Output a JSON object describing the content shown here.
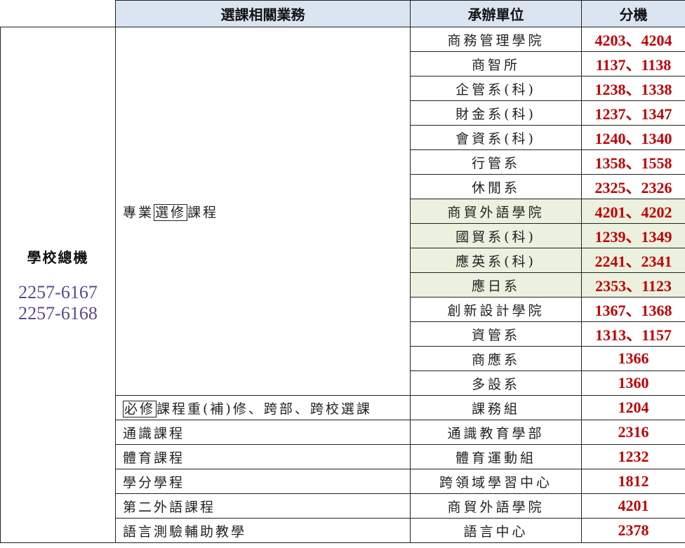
{
  "header": {
    "col_topic": "選課相關業務",
    "col_unit": "承辦單位",
    "col_ext": "分機"
  },
  "school": {
    "title": "學校總機",
    "phones": [
      "2257-6167",
      "2257-6168"
    ]
  },
  "elective": {
    "pre": "專業",
    "boxed": "選修",
    "post": "課程",
    "rows": [
      {
        "unit": "商務管理學院",
        "ext": "4203、4204"
      },
      {
        "unit": "商智所",
        "ext": "1137、1138"
      },
      {
        "unit": "企管系(科)",
        "ext": "1238、1338"
      },
      {
        "unit": "財金系(科)",
        "ext": "1237、1347"
      },
      {
        "unit": "會資系(科)",
        "ext": "1240、1340"
      },
      {
        "unit": "行管系",
        "ext": "1358、1558"
      },
      {
        "unit": "休閒系",
        "ext": "2325、2326"
      },
      {
        "unit": "商貿外語學院",
        "ext": "4201、4202"
      },
      {
        "unit": "國貿系(科)",
        "ext": "1239、1349"
      },
      {
        "unit": "應英系(科)",
        "ext": "2241、2341"
      },
      {
        "unit": "應日系",
        "ext": "2353、1123"
      },
      {
        "unit": "創新設計學院",
        "ext": "1367、1368"
      },
      {
        "unit": "資管系",
        "ext": "1313、1157"
      },
      {
        "unit": "商應系",
        "ext": "1366"
      },
      {
        "unit": "多設系",
        "ext": "1360"
      }
    ]
  },
  "required": {
    "boxed": "必修",
    "post": "課程重(補)修、跨部、跨校選課",
    "unit": "課務組",
    "ext": "1204"
  },
  "others": [
    {
      "topic": "通識課程",
      "unit": "通識教育學部",
      "ext": "2316"
    },
    {
      "topic": "體育課程",
      "unit": "體育運動組",
      "ext": "1232"
    },
    {
      "topic": "學分學程",
      "unit": "跨領域學習中心",
      "ext": "1812"
    },
    {
      "topic": "第二外語課程",
      "unit": "商貿外語學院",
      "ext": "4201"
    },
    {
      "topic": "語言測驗輔助教學",
      "unit": "語言中心",
      "ext": "2378"
    }
  ],
  "colors": {
    "header_bg": "#dbe5f1",
    "highlight_bg": "#ebf1de",
    "ext_text": "#c00000",
    "phone_text": "#5b4a8a"
  }
}
